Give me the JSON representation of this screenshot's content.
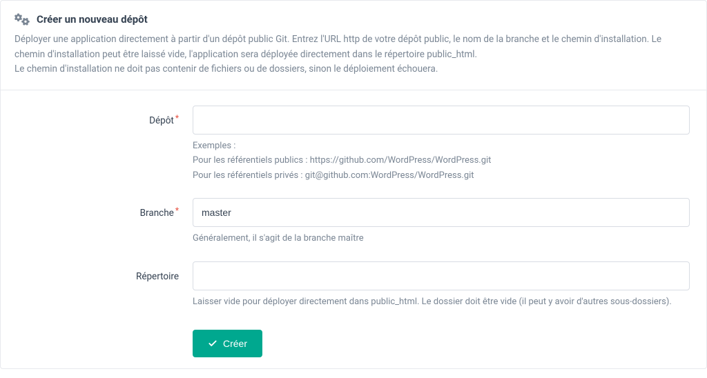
{
  "header": {
    "title": "Créer un nouveau dépôt",
    "description_line1": "Déployer une application directement à partir d'un dépôt public Git. Entrez l'URL http de votre dépôt public, le nom de la branche et le chemin d'installation. Le chemin d'installation peut être laissé vide, l'application sera déployée directement dans le répertoire public_html.",
    "description_line2": "Le chemin d'installation ne doit pas contenir de fichiers ou de dossiers, sinon le déploiement échouera."
  },
  "form": {
    "repo": {
      "label": "Dépôt",
      "value": "",
      "helper_intro": "Exemples :",
      "helper_line1": "Pour les référentiels publics : https://github.com/WordPress/WordPress.git",
      "helper_line2": "Pour les référentiels privés : git@github.com:WordPress/WordPress.git"
    },
    "branch": {
      "label": "Branche",
      "value": "master",
      "helper": "Généralement, il s'agit de la branche maître"
    },
    "directory": {
      "label": "Répertoire",
      "value": "",
      "helper": "Laisser vide pour déployer directement dans public_html. Le dossier doit être vide (il peut y avoir d'autres sous-dossiers)."
    },
    "submit_label": "Créer"
  }
}
